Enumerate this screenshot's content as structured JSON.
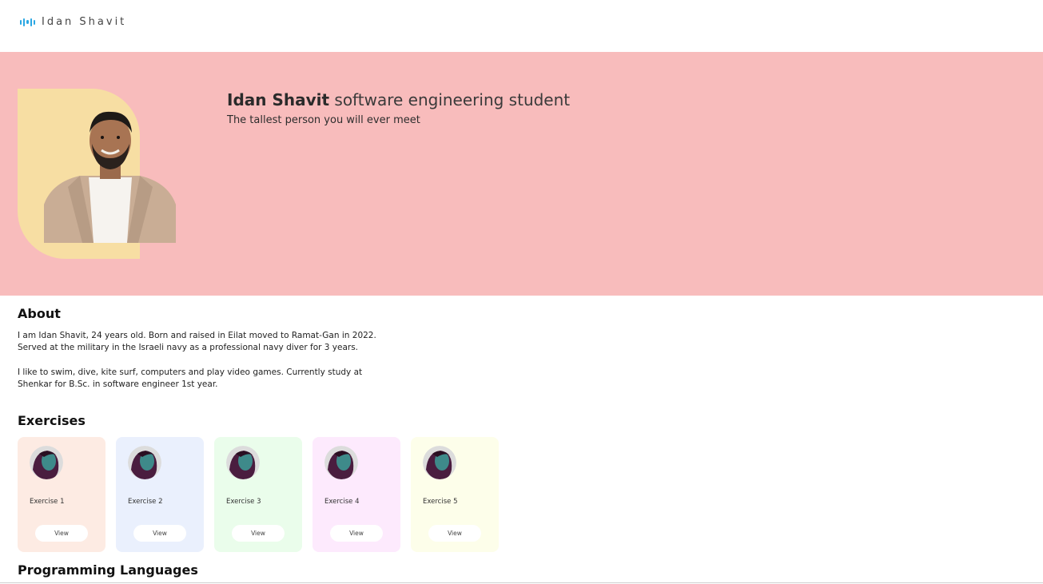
{
  "header": {
    "brand_name": "Idan Shavit",
    "brand_icon": "bars-logo-icon",
    "accent_color": "#2aa7e3"
  },
  "hero": {
    "background_color": "#f8bcbc",
    "name": "Idan Shavit",
    "title_rest": " software engineering student",
    "subtitle": "The tallest person you will ever meet"
  },
  "about": {
    "title": "About",
    "paragraph_1_line_1": "I am Idan Shavit, 24 years old. Born and raised in Eilat moved to Ramat-Gan in 2022.",
    "paragraph_1_line_2": "Served at the military in the Israeli navy as a professional navy diver for 3 years.",
    "paragraph_2_line_1": "I like to swim, dive, kite surf, computers and play video games. Currently study at",
    "paragraph_2_line_2": "Shenkar for B.Sc. in software engineer 1st year."
  },
  "exercises": {
    "title": "Exercises",
    "items": [
      {
        "label": "Exercise 1",
        "button": "View",
        "color": "#fdebe3"
      },
      {
        "label": "Exercise 2",
        "button": "View",
        "color": "#eaf0fd"
      },
      {
        "label": "Exercise 3",
        "button": "View",
        "color": "#eafdeb"
      },
      {
        "label": "Exercise 4",
        "button": "View",
        "color": "#fdeafd"
      },
      {
        "label": "Exercise 5",
        "button": "View",
        "color": "#fdfeea"
      }
    ]
  },
  "programming_languages": {
    "title": "Programming Languages"
  }
}
